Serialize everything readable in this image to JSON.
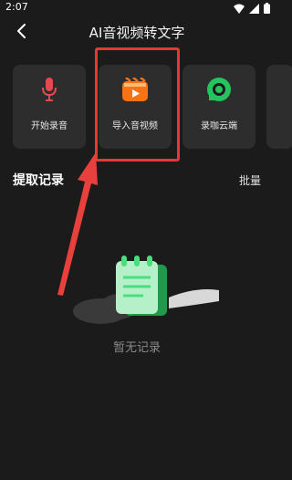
{
  "status_bar": {
    "time": "2:07"
  },
  "header": {
    "title": "AI音视频转文字"
  },
  "cards": [
    {
      "label": "开始录音",
      "icon": "microphone-icon"
    },
    {
      "label": "导入音视频",
      "icon": "video-import-icon"
    },
    {
      "label": "录咖云端",
      "icon": "cloud-app-icon"
    }
  ],
  "section": {
    "title": "提取记录",
    "action": "批量"
  },
  "empty": {
    "text": "暂无记录"
  },
  "colors": {
    "background": "#1b1b1b",
    "card": "#2d2d2d",
    "highlight": "#e53935",
    "mic": "#e5484d",
    "video": "#f97316",
    "cloud": "#22c55e"
  }
}
